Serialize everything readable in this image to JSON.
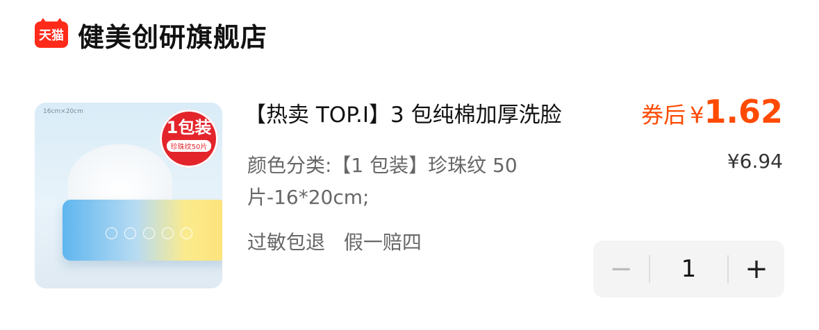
{
  "store": {
    "badge": "天猫",
    "name": "健美创研旗舰店"
  },
  "product": {
    "image": {
      "size_label": "16cm×20cm",
      "stamp_main": "1包装",
      "stamp_sub": "珍珠纹50片"
    },
    "title": "【热卖 TOP.I】3 包纯棉加厚洗脸",
    "variant": "颜色分类:【1 包装】珍珠纹 50 片-16*20cm;",
    "tags": [
      "过敏包退",
      "假一赔四"
    ],
    "coupon": {
      "label": "券后",
      "symbol": "¥",
      "value": "1.62"
    },
    "original_price": "¥6.94"
  },
  "stepper": {
    "minus": "−",
    "quantity": "1",
    "plus": "+"
  },
  "colors": {
    "accent": "#ff4a00",
    "tmall_red": "#ff2a1a"
  }
}
